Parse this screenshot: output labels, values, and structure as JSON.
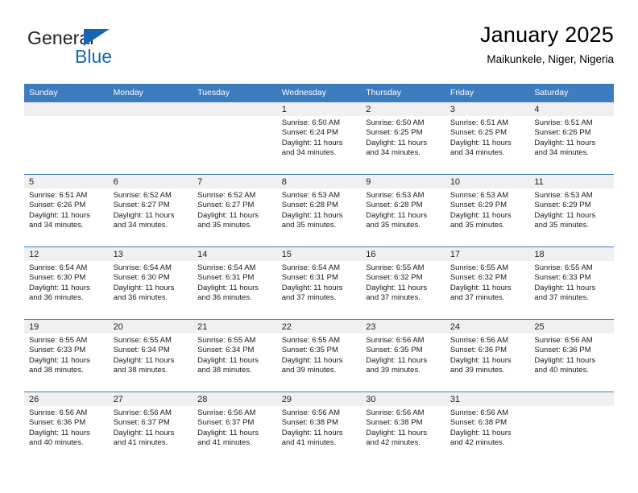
{
  "brand": {
    "name_top": "General",
    "name_bottom": "Blue",
    "accent_color": "#1566b2"
  },
  "header": {
    "title": "January 2025",
    "subtitle": "Maikunkele, Niger, Nigeria"
  },
  "calendar": {
    "header_bg": "#3c7cbf",
    "daynum_bg": "#f0f0f0",
    "weekday_headers": [
      "Sunday",
      "Monday",
      "Tuesday",
      "Wednesday",
      "Thursday",
      "Friday",
      "Saturday"
    ],
    "weeks": [
      [
        {
          "day": "",
          "empty": true
        },
        {
          "day": "",
          "empty": true
        },
        {
          "day": "",
          "empty": true
        },
        {
          "day": "1",
          "sunrise": "Sunrise: 6:50 AM",
          "sunset": "Sunset: 6:24 PM",
          "daylight_1": "Daylight: 11 hours",
          "daylight_2": "and 34 minutes."
        },
        {
          "day": "2",
          "sunrise": "Sunrise: 6:50 AM",
          "sunset": "Sunset: 6:25 PM",
          "daylight_1": "Daylight: 11 hours",
          "daylight_2": "and 34 minutes."
        },
        {
          "day": "3",
          "sunrise": "Sunrise: 6:51 AM",
          "sunset": "Sunset: 6:25 PM",
          "daylight_1": "Daylight: 11 hours",
          "daylight_2": "and 34 minutes."
        },
        {
          "day": "4",
          "sunrise": "Sunrise: 6:51 AM",
          "sunset": "Sunset: 6:26 PM",
          "daylight_1": "Daylight: 11 hours",
          "daylight_2": "and 34 minutes."
        }
      ],
      [
        {
          "day": "5",
          "sunrise": "Sunrise: 6:51 AM",
          "sunset": "Sunset: 6:26 PM",
          "daylight_1": "Daylight: 11 hours",
          "daylight_2": "and 34 minutes."
        },
        {
          "day": "6",
          "sunrise": "Sunrise: 6:52 AM",
          "sunset": "Sunset: 6:27 PM",
          "daylight_1": "Daylight: 11 hours",
          "daylight_2": "and 34 minutes."
        },
        {
          "day": "7",
          "sunrise": "Sunrise: 6:52 AM",
          "sunset": "Sunset: 6:27 PM",
          "daylight_1": "Daylight: 11 hours",
          "daylight_2": "and 35 minutes."
        },
        {
          "day": "8",
          "sunrise": "Sunrise: 6:53 AM",
          "sunset": "Sunset: 6:28 PM",
          "daylight_1": "Daylight: 11 hours",
          "daylight_2": "and 35 minutes."
        },
        {
          "day": "9",
          "sunrise": "Sunrise: 6:53 AM",
          "sunset": "Sunset: 6:28 PM",
          "daylight_1": "Daylight: 11 hours",
          "daylight_2": "and 35 minutes."
        },
        {
          "day": "10",
          "sunrise": "Sunrise: 6:53 AM",
          "sunset": "Sunset: 6:29 PM",
          "daylight_1": "Daylight: 11 hours",
          "daylight_2": "and 35 minutes."
        },
        {
          "day": "11",
          "sunrise": "Sunrise: 6:53 AM",
          "sunset": "Sunset: 6:29 PM",
          "daylight_1": "Daylight: 11 hours",
          "daylight_2": "and 35 minutes."
        }
      ],
      [
        {
          "day": "12",
          "sunrise": "Sunrise: 6:54 AM",
          "sunset": "Sunset: 6:30 PM",
          "daylight_1": "Daylight: 11 hours",
          "daylight_2": "and 36 minutes."
        },
        {
          "day": "13",
          "sunrise": "Sunrise: 6:54 AM",
          "sunset": "Sunset: 6:30 PM",
          "daylight_1": "Daylight: 11 hours",
          "daylight_2": "and 36 minutes."
        },
        {
          "day": "14",
          "sunrise": "Sunrise: 6:54 AM",
          "sunset": "Sunset: 6:31 PM",
          "daylight_1": "Daylight: 11 hours",
          "daylight_2": "and 36 minutes."
        },
        {
          "day": "15",
          "sunrise": "Sunrise: 6:54 AM",
          "sunset": "Sunset: 6:31 PM",
          "daylight_1": "Daylight: 11 hours",
          "daylight_2": "and 37 minutes."
        },
        {
          "day": "16",
          "sunrise": "Sunrise: 6:55 AM",
          "sunset": "Sunset: 6:32 PM",
          "daylight_1": "Daylight: 11 hours",
          "daylight_2": "and 37 minutes."
        },
        {
          "day": "17",
          "sunrise": "Sunrise: 6:55 AM",
          "sunset": "Sunset: 6:32 PM",
          "daylight_1": "Daylight: 11 hours",
          "daylight_2": "and 37 minutes."
        },
        {
          "day": "18",
          "sunrise": "Sunrise: 6:55 AM",
          "sunset": "Sunset: 6:33 PM",
          "daylight_1": "Daylight: 11 hours",
          "daylight_2": "and 37 minutes."
        }
      ],
      [
        {
          "day": "19",
          "sunrise": "Sunrise: 6:55 AM",
          "sunset": "Sunset: 6:33 PM",
          "daylight_1": "Daylight: 11 hours",
          "daylight_2": "and 38 minutes."
        },
        {
          "day": "20",
          "sunrise": "Sunrise: 6:55 AM",
          "sunset": "Sunset: 6:34 PM",
          "daylight_1": "Daylight: 11 hours",
          "daylight_2": "and 38 minutes."
        },
        {
          "day": "21",
          "sunrise": "Sunrise: 6:55 AM",
          "sunset": "Sunset: 6:34 PM",
          "daylight_1": "Daylight: 11 hours",
          "daylight_2": "and 38 minutes."
        },
        {
          "day": "22",
          "sunrise": "Sunrise: 6:55 AM",
          "sunset": "Sunset: 6:35 PM",
          "daylight_1": "Daylight: 11 hours",
          "daylight_2": "and 39 minutes."
        },
        {
          "day": "23",
          "sunrise": "Sunrise: 6:56 AM",
          "sunset": "Sunset: 6:35 PM",
          "daylight_1": "Daylight: 11 hours",
          "daylight_2": "and 39 minutes."
        },
        {
          "day": "24",
          "sunrise": "Sunrise: 6:56 AM",
          "sunset": "Sunset: 6:36 PM",
          "daylight_1": "Daylight: 11 hours",
          "daylight_2": "and 39 minutes."
        },
        {
          "day": "25",
          "sunrise": "Sunrise: 6:56 AM",
          "sunset": "Sunset: 6:36 PM",
          "daylight_1": "Daylight: 11 hours",
          "daylight_2": "and 40 minutes."
        }
      ],
      [
        {
          "day": "26",
          "sunrise": "Sunrise: 6:56 AM",
          "sunset": "Sunset: 6:36 PM",
          "daylight_1": "Daylight: 11 hours",
          "daylight_2": "and 40 minutes."
        },
        {
          "day": "27",
          "sunrise": "Sunrise: 6:56 AM",
          "sunset": "Sunset: 6:37 PM",
          "daylight_1": "Daylight: 11 hours",
          "daylight_2": "and 41 minutes."
        },
        {
          "day": "28",
          "sunrise": "Sunrise: 6:56 AM",
          "sunset": "Sunset: 6:37 PM",
          "daylight_1": "Daylight: 11 hours",
          "daylight_2": "and 41 minutes."
        },
        {
          "day": "29",
          "sunrise": "Sunrise: 6:56 AM",
          "sunset": "Sunset: 6:38 PM",
          "daylight_1": "Daylight: 11 hours",
          "daylight_2": "and 41 minutes."
        },
        {
          "day": "30",
          "sunrise": "Sunrise: 6:56 AM",
          "sunset": "Sunset: 6:38 PM",
          "daylight_1": "Daylight: 11 hours",
          "daylight_2": "and 42 minutes."
        },
        {
          "day": "31",
          "sunrise": "Sunrise: 6:56 AM",
          "sunset": "Sunset: 6:38 PM",
          "daylight_1": "Daylight: 11 hours",
          "daylight_2": "and 42 minutes."
        },
        {
          "day": "",
          "empty": true
        }
      ]
    ]
  }
}
